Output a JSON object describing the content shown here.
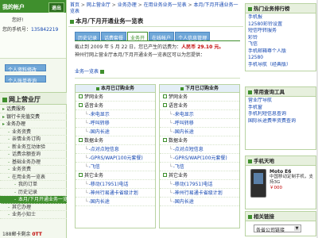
{
  "left": {
    "account_title": "我的帐户",
    "exit_label": "退出",
    "greeting": "您好!",
    "phone_label": "您的手机号：",
    "phone_number": "135842219",
    "buttons": [
      "个人资料修改",
      "个人账单查询"
    ],
    "hall_title": "网上营业厅",
    "menu": [
      {
        "label": "话费服务",
        "level": 0
      },
      {
        "label": "银行卡充值交费",
        "level": 0
      },
      {
        "label": "业务办理",
        "level": 0
      },
      {
        "label": "业务资费",
        "level": 1
      },
      {
        "label": "亲情业务订购",
        "level": 1
      },
      {
        "label": "新业务互动体验",
        "level": 1
      },
      {
        "label": "话费余额查询",
        "level": 1
      },
      {
        "label": "基础业务办理",
        "level": 1
      },
      {
        "label": "业务资费",
        "level": 1
      },
      {
        "label": "在用业务一览表",
        "level": 1
      },
      {
        "label": "我的订单",
        "level": 2
      },
      {
        "label": "历史记录",
        "level": 2
      },
      {
        "label": "本月/下月开通业务一览表",
        "level": 2,
        "active": true
      },
      {
        "label": "其它办理",
        "level": 1
      },
      {
        "label": "业务小知士",
        "level": 1
      }
    ],
    "count_prefix": "188郵卡剩余",
    "count_value": "0TT"
  },
  "center": {
    "breadcrumb": [
      "首页",
      "网上营业厅",
      "业务办理",
      "在用业务业务一览表",
      "本月/下月开通业务一览表"
    ],
    "title": "本月/下月开通业务一览表",
    "tabs": [
      {
        "label": "历史记录",
        "active": false
      },
      {
        "label": "话费套餐",
        "active": false
      },
      {
        "label": "业务开",
        "active": true
      },
      {
        "label": "在线帐户",
        "active": false
      },
      {
        "label": "个人信息管理",
        "active": false
      }
    ],
    "info_line1_pre": "截止到 2009 年 5 月 22 日，您已产生的话费为：",
    "info_line1_amount": "人民币 29.10 元。",
    "info_line2": "神州行网上营业厅本月/下月开通业务一览表区可以为您提供：",
    "biz_link": "业务一览表",
    "panels": [
      {
        "title": "本月已订购业务",
        "rows": [
          {
            "t": "cat",
            "label": "梦网业务"
          },
          {
            "t": "cat",
            "label": "语音业务"
          },
          {
            "t": "item",
            "label": "来电显示"
          },
          {
            "t": "item",
            "label": "呼叫转移"
          },
          {
            "t": "item",
            "label": "国内长途"
          },
          {
            "t": "cat",
            "label": "数据业务"
          },
          {
            "t": "item",
            "label": "点对点短信息"
          },
          {
            "t": "item",
            "label": "GPRS/WAP(100元套餐)"
          },
          {
            "t": "item",
            "label": "飞信"
          },
          {
            "t": "cat",
            "label": "其它业务"
          },
          {
            "t": "item",
            "label": "移动(17951)电话"
          },
          {
            "t": "item",
            "label": "神州行易通卡省级计划"
          },
          {
            "t": "item",
            "label": "国内长途"
          }
        ]
      },
      {
        "title": "下月已订购业务",
        "rows": [
          {
            "t": "cat",
            "label": "梦网业务"
          },
          {
            "t": "cat",
            "label": "语音业务"
          },
          {
            "t": "item",
            "label": "来电显示"
          },
          {
            "t": "item",
            "label": "呼叫转移"
          },
          {
            "t": "item",
            "label": "国内长途"
          },
          {
            "t": "cat",
            "label": "数据业务"
          },
          {
            "t": "item",
            "label": "点对点短信息"
          },
          {
            "t": "item",
            "label": "GPRS/WAP(100元套餐)"
          },
          {
            "t": "item",
            "label": "飞信"
          },
          {
            "t": "cat",
            "label": "其它业务"
          },
          {
            "t": "item",
            "label": "移动(17951)电话"
          },
          {
            "t": "item",
            "label": "神州行易通卡省级计划"
          },
          {
            "t": "item",
            "label": "国内长途"
          }
        ]
      }
    ]
  },
  "right": {
    "hot_title": "热门业务排行榜",
    "hot_items": [
      "手机报",
      "12580彩铃设置",
      "短信呼转服务",
      "彩铃",
      "飞信",
      "手机邮箱尊个人版",
      "12580",
      "手机导航（经典版）"
    ],
    "tools_title": "常用查询工具",
    "tools_items": [
      "营业厅导航",
      "手机窗",
      "手机利短信息查询",
      "国际长途费率资费查询"
    ],
    "phone_title": "手机天地",
    "phone_model": "Moto E6",
    "phone_desc": "中国移动定制手机，支持3G",
    "phone_price": "￥000",
    "links_title": "相关链接",
    "links_select": "各省公司链接"
  }
}
